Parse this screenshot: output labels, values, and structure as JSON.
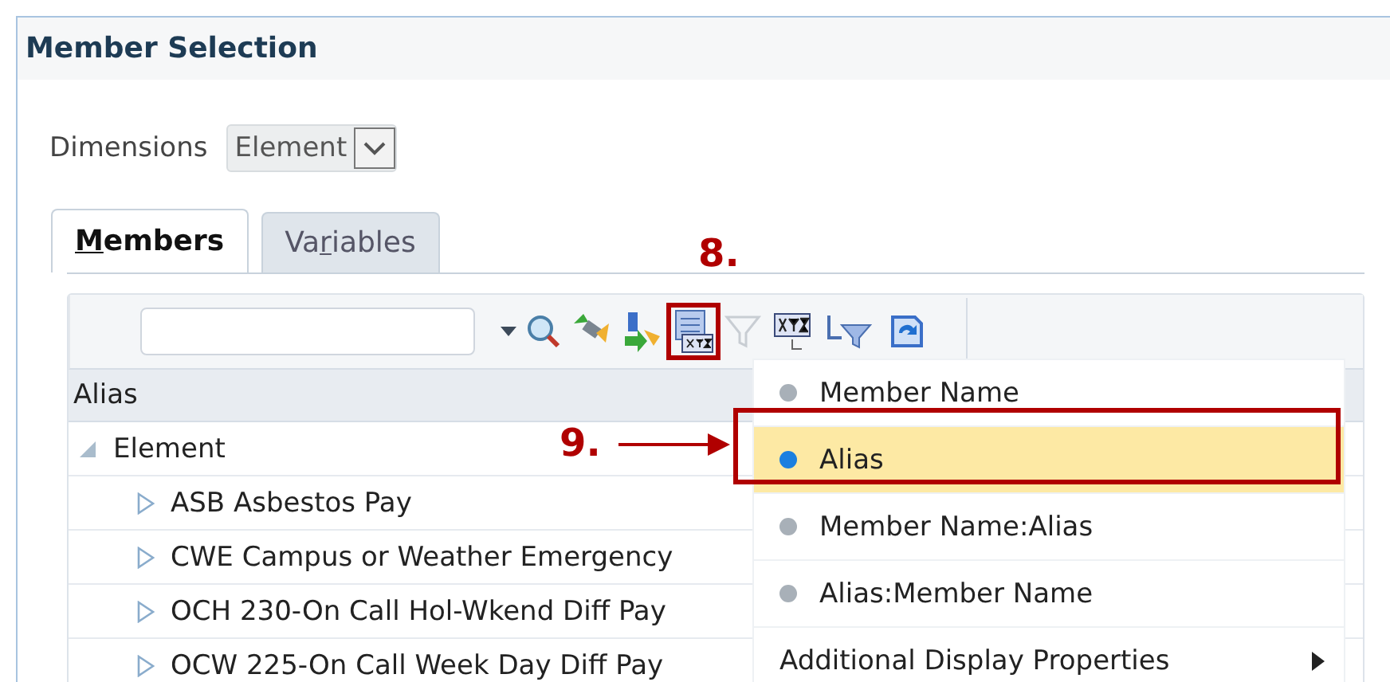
{
  "window": {
    "title": "Member Selection"
  },
  "dimensions": {
    "label": "Dimensions",
    "value": "Element"
  },
  "tabs": [
    {
      "mnemonic": "M",
      "rest": "embers",
      "selected": true
    },
    {
      "prefix": "Va",
      "mnemonic": "r",
      "rest": "iables",
      "selected": false
    }
  ],
  "tree": {
    "column": "Alias",
    "root": {
      "label": "Element",
      "expanded": true,
      "children": [
        {
          "label": "ASB Asbestos Pay",
          "expanded": false
        },
        {
          "label": "CWE Campus or Weather Emergency",
          "expanded": false
        },
        {
          "label": "OCH 230-On Call Hol-Wkend Diff Pay",
          "expanded": false
        },
        {
          "label": "OCW 225-On Call Week Day Diff Pay",
          "expanded": false
        }
      ]
    }
  },
  "menu": {
    "items": [
      {
        "kind": "radio",
        "label": "Member Name",
        "selected": false
      },
      {
        "kind": "radio",
        "label": "Alias",
        "selected": true
      },
      {
        "kind": "radio",
        "label": "Member Name:Alias",
        "selected": false
      },
      {
        "kind": "radio",
        "label": "Alias:Member Name",
        "selected": false
      },
      {
        "kind": "submenu",
        "label": "Additional Display Properties"
      }
    ]
  },
  "annotations": [
    {
      "label": "8."
    },
    {
      "label": "9."
    }
  ]
}
